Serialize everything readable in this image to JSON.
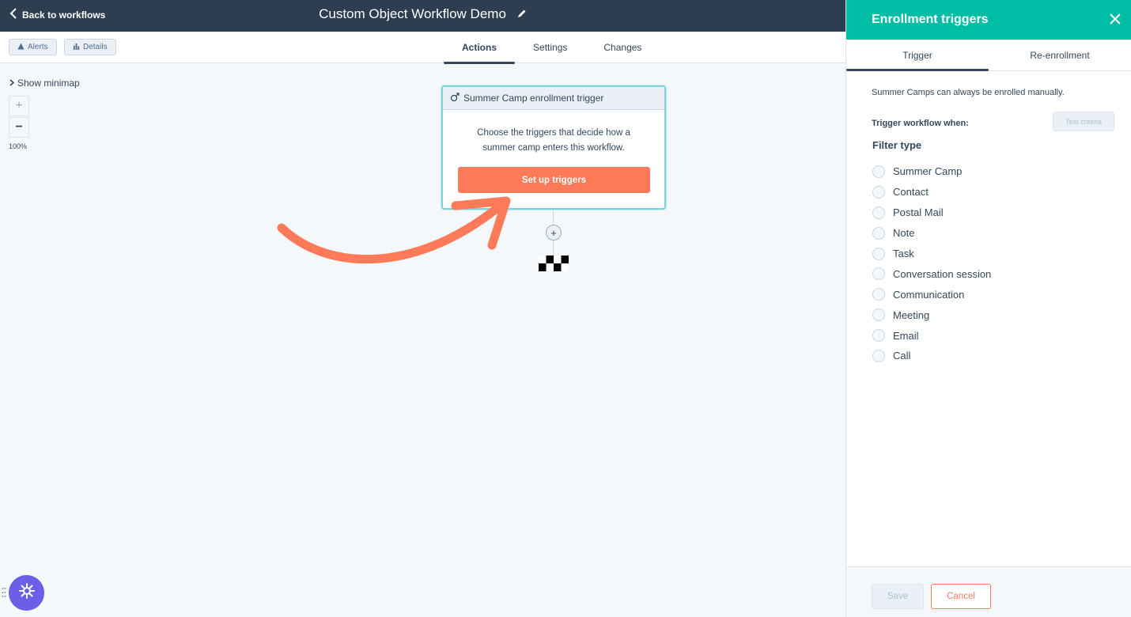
{
  "topbar": {
    "back_label": "Back to workflows",
    "title": "Custom Object Workflow Demo"
  },
  "subbar": {
    "alerts_label": "Alerts",
    "details_label": "Details",
    "tabs": [
      {
        "label": "Actions",
        "active": true
      },
      {
        "label": "Settings",
        "active": false
      },
      {
        "label": "Changes",
        "active": false
      }
    ]
  },
  "canvas": {
    "minimap_label": "Show minimap",
    "zoom_in": "+",
    "zoom_out": "−",
    "zoom_level": "100%",
    "add_node": "+"
  },
  "trigger_card": {
    "header": "Summer Camp enrollment trigger",
    "description": "Choose the triggers that decide how a summer camp enters this workflow.",
    "button_label": "Set up triggers"
  },
  "panel": {
    "title": "Enrollment triggers",
    "tabs": [
      {
        "label": "Trigger",
        "active": true
      },
      {
        "label": "Re-enrollment",
        "active": false
      }
    ],
    "note": "Summer Camps can always be enrolled manually.",
    "trigger_when": "Trigger workflow when:",
    "test_criteria": "Test criteria",
    "filter_type_label": "Filter type",
    "filters": [
      "Summer Camp",
      "Contact",
      "Postal Mail",
      "Note",
      "Task",
      "Conversation session",
      "Communication",
      "Meeting",
      "Email",
      "Call"
    ],
    "save_label": "Save",
    "cancel_label": "Cancel"
  },
  "colors": {
    "topbar": "#2d3e50",
    "panel_header": "#00bda5",
    "accent": "#ff7a59",
    "card_border": "#7fd1de",
    "help_widget": "#6a5fe6"
  }
}
